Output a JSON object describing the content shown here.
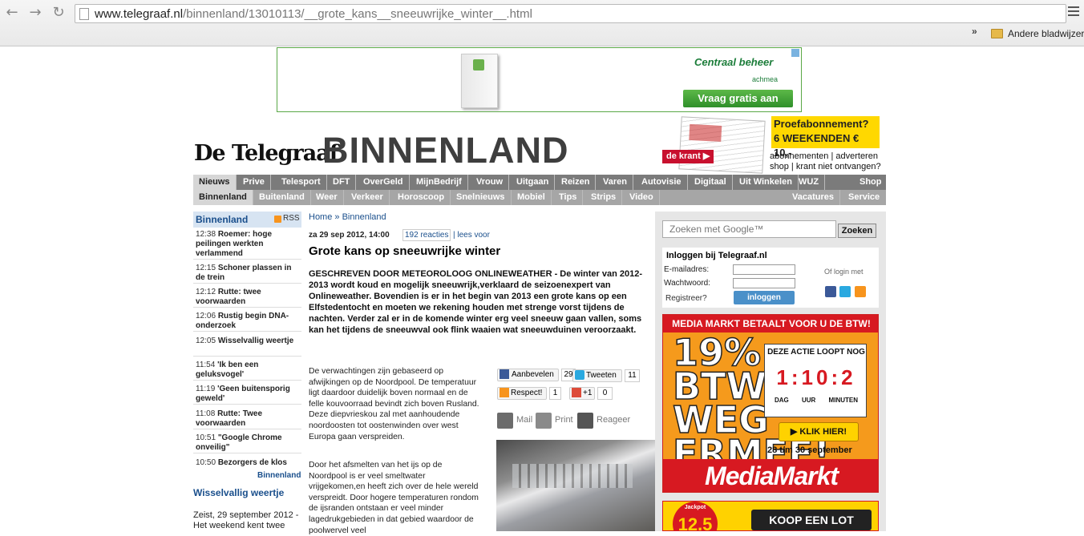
{
  "browser": {
    "url_host": "www.telegraaf.nl",
    "url_path": "/binnenland/13010113/__grote_kans__sneeuwrijke_winter__.html",
    "bookmarks_chevron": "»",
    "bookmarks_folder": "Andere bladwijzers"
  },
  "top_ad": {
    "brand": "Centraal beheer",
    "sub": "achmea",
    "cta": "Vraag gratis aan"
  },
  "header": {
    "logo": "De Telegraaf",
    "section": "BINNENLAND",
    "dekrant": "de krant ▶",
    "promo_title": "Proefabonnement?",
    "promo_offer": "6 WEEKENDEN € 10,-",
    "promo_links_1": "abonnementen | adverteren",
    "promo_links_2": "shop | krant niet ontvangen?"
  },
  "nav_primary": [
    "Nieuws",
    "Prive",
    "Telesport",
    "DFT",
    "OverGeld",
    "MijnBedrijf",
    "Vrouw",
    "Uitgaan",
    "Reizen",
    "Varen",
    "Autovisie",
    "Digitaal",
    "Uit Winkelen",
    "WUZ",
    "Shop"
  ],
  "nav_secondary": [
    "Binnenland",
    "Buitenland",
    "Weer",
    "Verkeer",
    "Horoscoop",
    "Snelnieuws",
    "Mobiel",
    "Tips",
    "Strips",
    "Video",
    "Vacatures",
    "Service"
  ],
  "left": {
    "heading": "Binnenland",
    "rss": "RSS",
    "items": [
      {
        "time": "12:38",
        "title": "Roemer: hoge peilingen werkten verlammend"
      },
      {
        "time": "12:15",
        "title": "Schoner plassen in de trein"
      },
      {
        "time": "12:12",
        "title": "Rutte: twee voorwaarden"
      },
      {
        "time": "12:06",
        "title": "Rustig begin DNA-onderzoek"
      },
      {
        "time": "12:05",
        "title": "Wisselvallig weertje"
      },
      {
        "time": "11:54",
        "title": "'Ik ben een geluksvogel'"
      },
      {
        "time": "11:19",
        "title": "'Geen buitensporig geweld'"
      },
      {
        "time": "11:08",
        "title": "Rutte: Twee voorwaarden"
      },
      {
        "time": "10:51",
        "title": "\"Google Chrome onveilig\""
      },
      {
        "time": "10:50",
        "title": "Bezorgers de klos"
      }
    ],
    "more": "Binnenland",
    "weather_title": "Wisselvallig weertje",
    "weather_intro": "Zeist, 29 september 2012 - Het weekend kent twee"
  },
  "article": {
    "crumb_home": "Home",
    "crumb_sep": "»",
    "crumb_section": "Binnenland",
    "date": "za 29 sep 2012, 14:00",
    "reacties": "192 reacties",
    "lees_voor": "| lees voor",
    "title": "Grote kans op sneeuwrijke winter",
    "lead": "GESCHREVEN DOOR METEOROLOOG ONLINEWEATHER - De winter van 2012-2013 wordt koud en mogelijk sneeuwrijk,verklaard de seizoenexpert van Onlineweather. Bovendien is er in het begin van 2013 een grote kans op een Elfstedentocht en moeten we rekening houden met strenge vorst tijdens de nachten. Verder zal er in de komende winter erg veel sneeuw gaan vallen, soms kan het tijdens de sneeuwval ook flink waaien wat sneeuwduinen veroorzaakt.",
    "body1": "De verwachtingen zijn gebaseerd op afwijkingen op de Noordpool. De temperatuur ligt daardoor duidelijk boven normaal en de felle kouvoorraad bevindt zich boven Rusland. Deze diepvrieskou zal met aanhoudende noordoosten tot oostenwinden over west Europa gaan verspreiden.",
    "body2": "Door het afsmelten van het ijs op de Noordpool is er veel smeltwater vrijgekomen,en heeft zich over de hele wereld verspreidt. Door hogere temperaturen rondom de ijsranden ontstaan er veel minder lagedrukgebieden in dat gebied waardoor de poolwervel veel",
    "share": {
      "fb_label": "Aanbevelen",
      "fb_count": "29",
      "tw_label": "Tweeten",
      "tw_count": "11",
      "hy_label": "Respect!",
      "hy_count": "1",
      "gp_label": "+1",
      "gp_count": "0"
    },
    "actions": {
      "mail": "Mail",
      "print": "Print",
      "report": "Reageer"
    }
  },
  "right": {
    "search_placeholder": "Zoeken met Google™",
    "search_button": "Zoeken",
    "login_title": "Inloggen bij Telegraaf.nl",
    "email_label": "E-mailadres:",
    "password_label": "Wachtwoord:",
    "register": "Registreer?",
    "login_button": "inloggen",
    "alt_login": "Of login met"
  },
  "mm_ad": {
    "top": "MEDIA MARKT BETAALT VOOR U DE BTW!",
    "big": "19% BTW WEG ERMEE!",
    "timer_title": "DEZE ACTIE LOOPT NOG",
    "timer": "1:10:2",
    "timer_units": "DAG UUR MINUTEN",
    "klik": "▶ KLIK HIER!",
    "date": "28 t/m 30 september",
    "logo": "MediaMarkt"
  },
  "lot_ad": {
    "jackpot": "Jackpot",
    "amount": "12,5",
    "button": "KOOP EEN LOT"
  },
  "colors": {
    "link": "#1a4f8c",
    "nav_primary": "#7b7b7b",
    "nav_secondary": "#a6a6a6",
    "mediamarkt_red": "#d71921"
  }
}
